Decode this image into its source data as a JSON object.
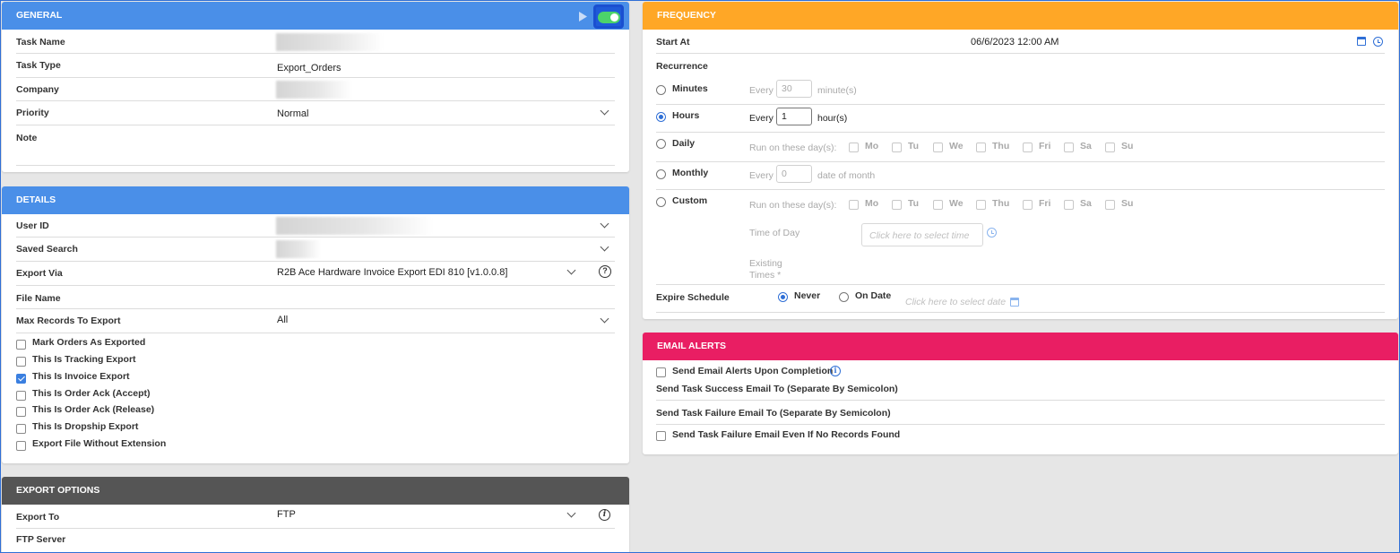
{
  "general": {
    "title": "GENERAL",
    "task_name_label": "Task Name",
    "task_type_label": "Task Type",
    "task_type_value": "Export_Orders",
    "company_label": "Company",
    "priority_label": "Priority",
    "priority_value": "Normal",
    "note_label": "Note",
    "enabled": true
  },
  "details": {
    "title": "DETAILS",
    "user_id_label": "User ID",
    "saved_search_label": "Saved Search",
    "export_via_label": "Export Via",
    "export_via_value": "R2B Ace Hardware Invoice Export EDI 810 [v1.0.0.8]",
    "help_symbol": "?",
    "file_name_label": "File Name",
    "max_records_label": "Max Records To Export",
    "max_records_value": "All",
    "checkboxes": [
      {
        "label": "Mark Orders As Exported",
        "checked": false
      },
      {
        "label": "This Is Tracking Export",
        "checked": false
      },
      {
        "label": "This Is Invoice Export",
        "checked": true
      },
      {
        "label": "This Is Order Ack (Accept)",
        "checked": false
      },
      {
        "label": "This Is Order Ack (Release)",
        "checked": false
      },
      {
        "label": "This Is Dropship Export",
        "checked": false
      },
      {
        "label": "Export File Without Extension",
        "checked": false
      }
    ]
  },
  "export_options": {
    "title": "EXPORT OPTIONS",
    "export_to_label": "Export To",
    "export_to_value": "FTP",
    "info_symbol": "i",
    "ftp_server_label": "FTP Server"
  },
  "frequency": {
    "title": "FREQUENCY",
    "start_at_label": "Start At",
    "start_at_value": "06/6/2023 12:00 AM",
    "recurrence_label": "Recurrence",
    "minutes": {
      "label": "Minutes",
      "every": "Every",
      "value": "30",
      "unit": "minute(s)"
    },
    "hours": {
      "label": "Hours",
      "every": "Every",
      "value": "1",
      "unit": "hour(s)"
    },
    "daily": {
      "label": "Daily",
      "run_on": "Run on these day(s):"
    },
    "monthly": {
      "label": "Monthly",
      "every": "Every",
      "value": "0",
      "unit": "date of month"
    },
    "custom": {
      "label": "Custom",
      "run_on": "Run on these day(s):"
    },
    "days": [
      "Mo",
      "Tu",
      "We",
      "Thu",
      "Fri",
      "Sa",
      "Su"
    ],
    "time_of_day_label": "Time of Day",
    "time_placeholder": "Click here to select time",
    "existing_times_label": "Existing Times *",
    "expire_schedule_label": "Expire Schedule",
    "never_label": "Never",
    "on_date_label": "On Date",
    "date_placeholder": "Click here to select date"
  },
  "email_alerts": {
    "title": "EMAIL ALERTS",
    "send_on_completion": "Send Email Alerts Upon Completion",
    "info_symbol": "i",
    "success_label": "Send Task Success Email To (Separate By Semicolon)",
    "failure_label": "Send Task Failure Email To (Separate By Semicolon)",
    "failure_no_records": "Send Task Failure Email Even If No Records Found"
  }
}
